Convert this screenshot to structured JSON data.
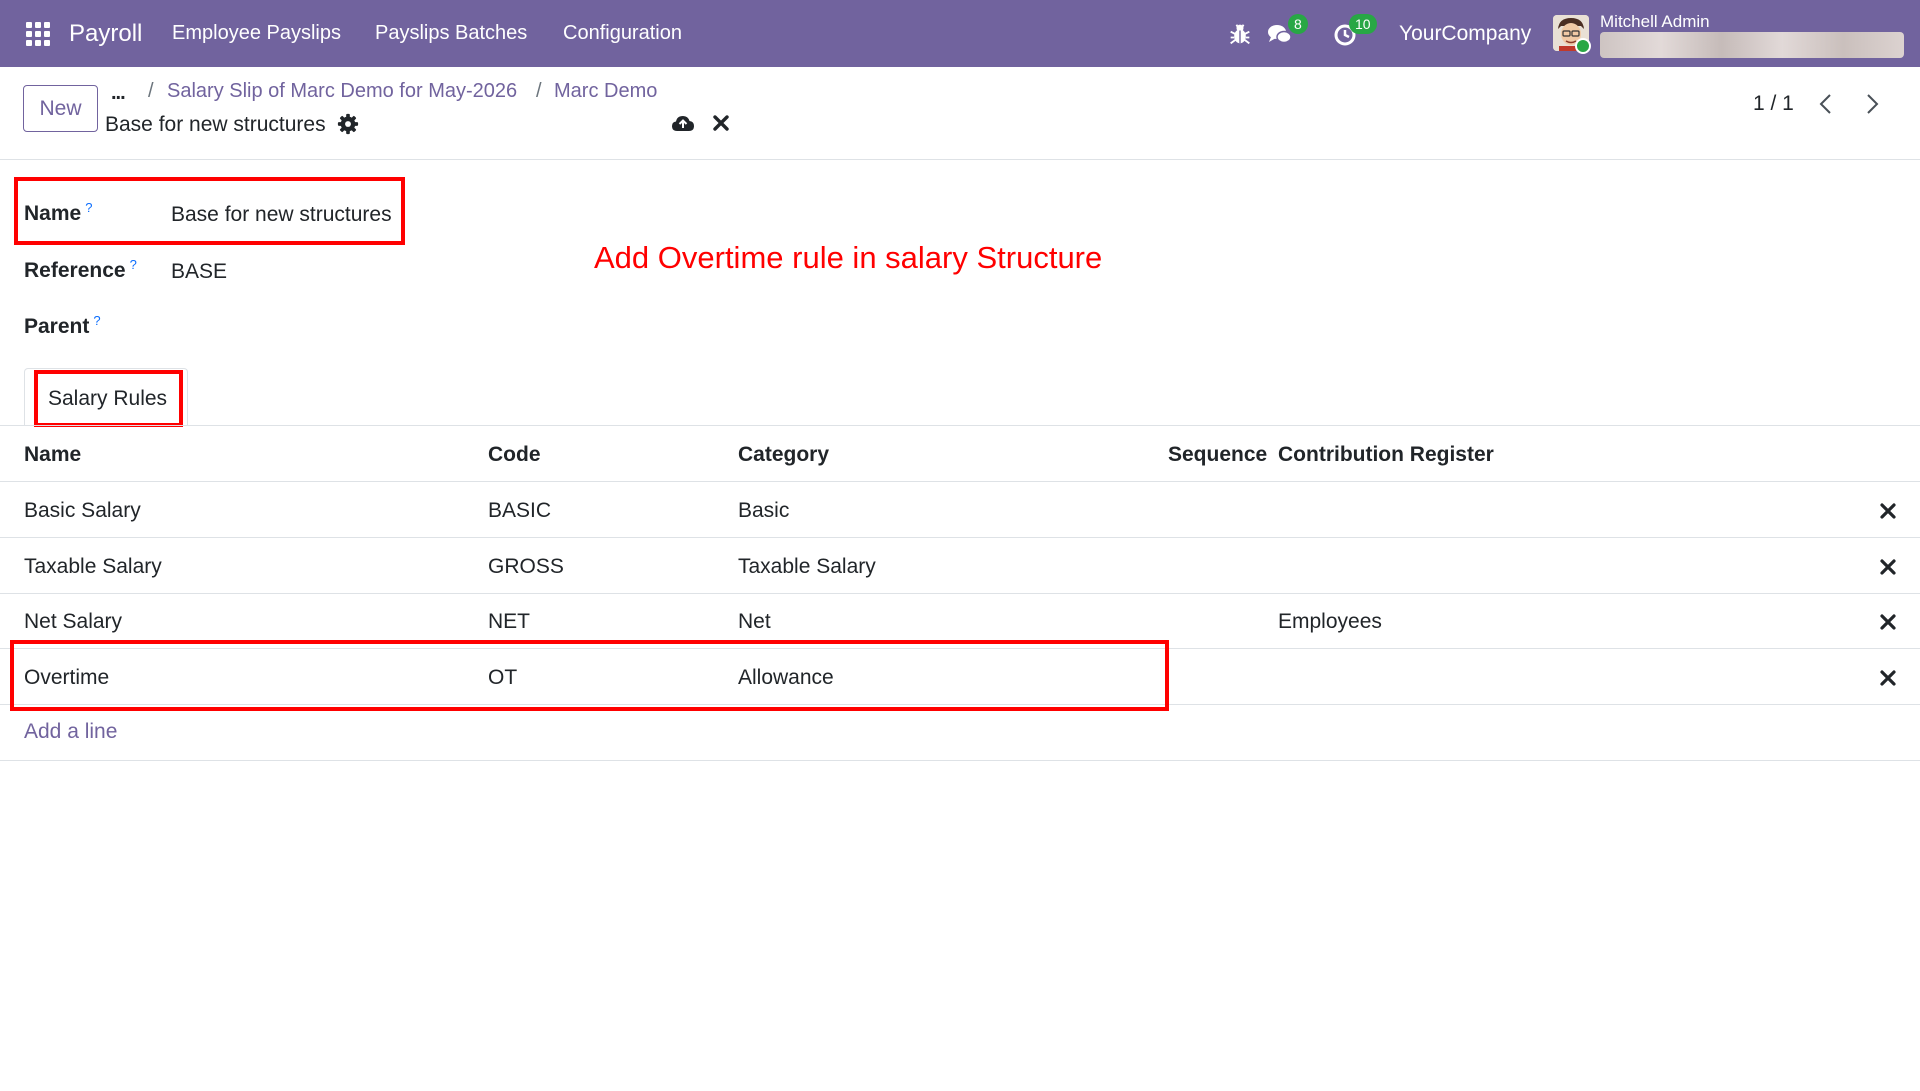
{
  "navbar": {
    "brand": "Payroll",
    "menu": [
      "Employee Payslips",
      "Payslips Batches",
      "Configuration"
    ],
    "icons": [
      "apps-grid-icon",
      "bug-icon",
      "chat-icon",
      "activity-clock-icon"
    ],
    "messages_count": "8",
    "activities_count": "10",
    "company": "YourCompany",
    "user_name": "Mitchell Admin",
    "accent_color": "#71639e",
    "badge_color": "#28a745"
  },
  "control_panel": {
    "new_label": "New",
    "ellipsis": "...",
    "breadcrumbs": [
      "Salary Slip of Marc Demo for May-2026",
      "Marc Demo"
    ],
    "separator": "/",
    "record_title": "Base for new structures",
    "pager": "1 / 1"
  },
  "form": {
    "fields": [
      {
        "label": "Name",
        "help": "?",
        "value": "Base for new structures"
      },
      {
        "label": "Reference",
        "help": "?",
        "value": "BASE"
      },
      {
        "label": "Parent",
        "help": "?",
        "value": ""
      }
    ],
    "annotation": "Add Overtime rule in salary Structure",
    "highlight_color": "#ff0000"
  },
  "notebook": {
    "tabs": [
      "Salary Rules"
    ]
  },
  "salary_rules": {
    "columns": [
      "Name",
      "Code",
      "Category",
      "Sequence",
      "Contribution Register"
    ],
    "rows": [
      {
        "name": "Basic Salary",
        "code": "BASIC",
        "category": "Basic",
        "sequence": "",
        "register": ""
      },
      {
        "name": "Taxable Salary",
        "code": "GROSS",
        "category": "Taxable Salary",
        "sequence": "",
        "register": ""
      },
      {
        "name": "Net Salary",
        "code": "NET",
        "category": "Net",
        "sequence": "",
        "register": "Employees"
      },
      {
        "name": "Overtime",
        "code": "OT",
        "category": "Allowance",
        "sequence": "",
        "register": ""
      }
    ],
    "add_line": "Add a line"
  }
}
